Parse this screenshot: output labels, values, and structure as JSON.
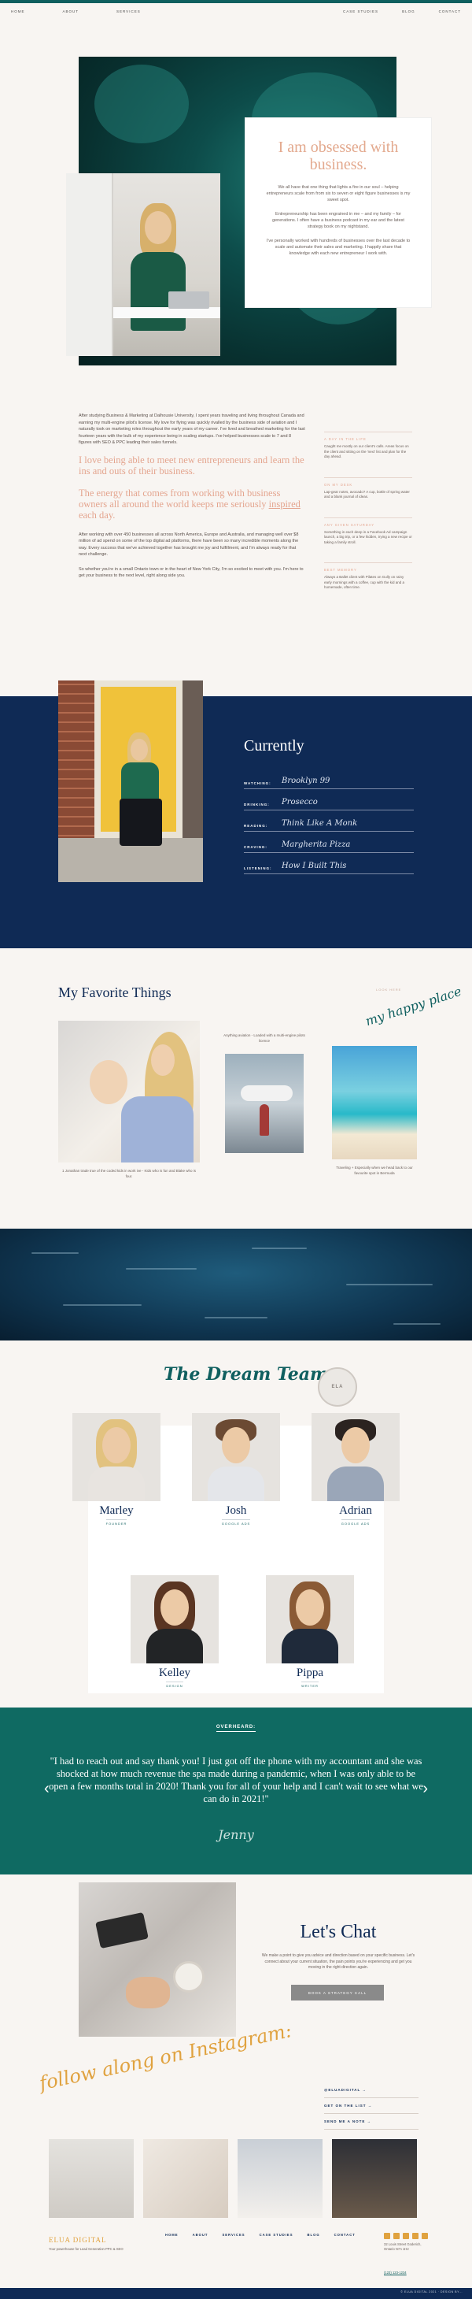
{
  "nav": {
    "left": [
      "HOME",
      "ABOUT",
      "SERVICES"
    ],
    "right": [
      "CASE STUDIES",
      "BLOG",
      "CONTACT"
    ]
  },
  "hero": {
    "heading": "I am obsessed with business.",
    "p1": "We all have that one thing that lights a fire in our soul – helping entrepreneurs scale from from six to seven or eight figure businesses is my sweet spot.",
    "p2": "Entrepreneurship has been engrained in me – and my family – for generations. I often have a business podcast in my ear and the latest strategy book on my nightstand.",
    "p3": "I've personally worked with hundreds of businesses over the last decade to scale and automate their sales and marketing. I happily share that knowledge with each new entrepreneur I work with."
  },
  "bio": {
    "p1": "After studying Business & Marketing at Dalhousie University, I spent years traveling and living throughout Canada and earning my multi-engine pilot's license. My love for flying was quickly rivalled by the business side of aviation and I naturally took on marketing roles throughout the early years of my career. I've lived and breathed marketing for the last fourteen years with the bulk of my experience being in scaling startups. I've helped businesses scale to 7 and 8 figures with SEO & PPC leading their sales funnels.",
    "quote1": "I love being able to meet new entrepreneurs and learn the ins and outs of their business.",
    "quote2_a": "The energy that comes from working with business owners all around the world keeps me seriously ",
    "quote2_u": "inspired",
    "quote2_b": " each day.",
    "p2": "After working with over 450 businesses all across North America, Europe and Australia, and managing well over $8 million of ad spend on some of the top digital ad platforms, there have been so many incredible moments along the way. Every success that we've achieved together has brought me joy and fulfillment, and I'm always ready for that next challenge.",
    "p3": "So whether you're in a small Ontario town or in the heart of New York City, I'm so excited to meet with you. I'm here to get your business to the next level, right along side you.",
    "side": [
      {
        "title": "A DAY IN THE LIFE",
        "text": "Caught me mostly on our client's calls. Areas focus on the client and sitting on the 'next' list and plan for the day ahead."
      },
      {
        "title": "ON MY DESK",
        "text": "Lap-gear notes, avocado? A cup, bottle of spring water and a blank journal of ideas."
      },
      {
        "title": "ANY GIVEN SATURDAY",
        "text": "Something in each deep in a Facebook Ad campaign launch, a big trip, or a few hidden, trying a new recipe or taking a family stroll."
      },
      {
        "title": "BEST MEMORY",
        "text": "Always a Ballet client with Pilates on Gully on rainy early mornings with a coffee, cup with the kid and a homemade, often time."
      }
    ]
  },
  "currently": {
    "title": "Currently",
    "rows": [
      {
        "label": "WATCHING:",
        "value": "Brooklyn 99"
      },
      {
        "label": "DRINKING:",
        "value": "Prosecco"
      },
      {
        "label": "READING:",
        "value": "Think Like A Monk"
      },
      {
        "label": "CRAVING:",
        "value": "Margherita Pizza"
      },
      {
        "label": "LISTENING:",
        "value": "How I Built This"
      }
    ]
  },
  "fav": {
    "title": "My Favorite Things",
    "look_label": "LOOK HERE",
    "look_script": "my happy place",
    "cap1": "1 Jonathan trade true of the coded kids in work ive - Kids who is fun and Blake who is four.",
    "cap2": "Anything aviation - Loaded with a multi-engine pilots licence",
    "cap3": "Traveling + Especially when we head back to our favourite spot in Bermuda"
  },
  "team": {
    "title": "The Dream Team",
    "logo": "ELA",
    "members": [
      {
        "name": "Marley",
        "role": "FOUNDER"
      },
      {
        "name": "Josh",
        "role": "GOOGLE ADS"
      },
      {
        "name": "Adrian",
        "role": "GOOGLE ADS"
      },
      {
        "name": "Kelley",
        "role": "DESIGN"
      },
      {
        "name": "Pippa",
        "role": "WRITER"
      }
    ]
  },
  "testimonial": {
    "label": "OVERHEARD:",
    "quote": "\"I had to reach out and say thank you! I just got off the phone with my accountant and she was shocked at how much revenue the spa made during a pandemic, when I was only able to be open a few months total in 2020! Thank you for all of your help and I can't wait to see what we can do in 2021!\"",
    "signature": "Jenny",
    "prev": "‹",
    "next": "›"
  },
  "chat": {
    "title": "Let's Chat",
    "text": "We make a point to give you advice and direction based on your specific business. Let's connect about your current situation, the pain points you're experiencing and get you moving in the right direction again.",
    "button": "BOOK A STRATEGY CALL"
  },
  "insta": {
    "script": "follow along on Instagram:",
    "links": [
      "@ELUADIGITAL →",
      "GET ON THE LIST →",
      "SEND ME A NOTE →"
    ]
  },
  "footer": {
    "brand": "ELUA DIGITAL",
    "tagline": "Your powerhouse for Lead Generation PPC & SEO",
    "nav": [
      "HOME",
      "ABOUT",
      "SERVICES",
      "CASE STUDIES",
      "BLOG",
      "CONTACT"
    ],
    "address": "32 Louis Street Goderich, Ontario N7A 1H2",
    "phone": "(123) 123-1234",
    "copyright": "© ELUA DIGITAL 2021 · DESIGN BY..."
  }
}
